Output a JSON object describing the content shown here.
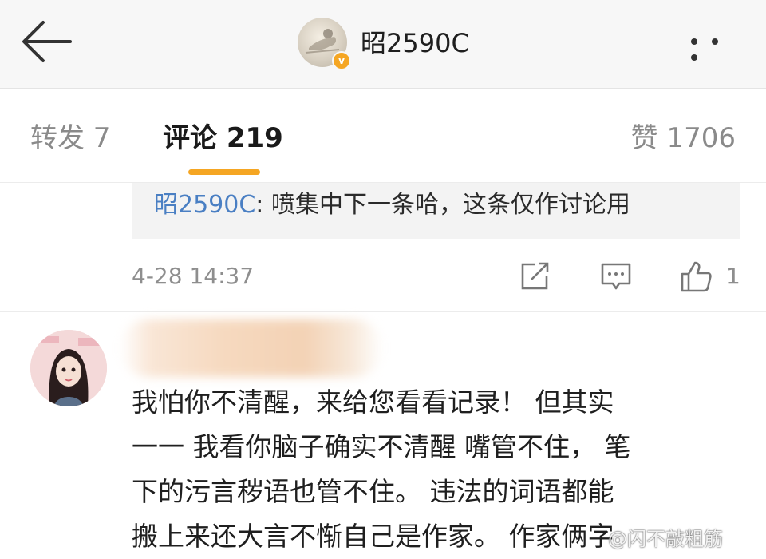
{
  "header": {
    "title": "昭2590C",
    "back_icon": "arrow-left-icon",
    "more_icon": "more-dots-icon",
    "verified_icon": "verified-badge-icon",
    "verified_color": "#f5a623"
  },
  "tabs": {
    "repost_label": "转发 7",
    "comment_label": "评论 219",
    "like_label": "赞 1706",
    "active_color": "#f5a623"
  },
  "quoted_reply": {
    "user": "昭2590C",
    "text": ": 喷集中下一条哈，这条仅作讨论用"
  },
  "reply_meta": {
    "time": "4-28 14:37",
    "like_count": "1",
    "icons": [
      "share-icon",
      "comment-icon",
      "thumbs-up-icon"
    ]
  },
  "comment": {
    "lines": [
      "我怕你不清醒，来给您看看记录！ 但其实",
      "一一 我看你脑子确实不清醒 嘴管不住， 笔",
      "下的污言秽语也管不住。 违法的词语都能",
      "搬上来还大言不惭自己是作家。 作家俩字"
    ]
  },
  "watermark": "@闪不敲粗筋"
}
